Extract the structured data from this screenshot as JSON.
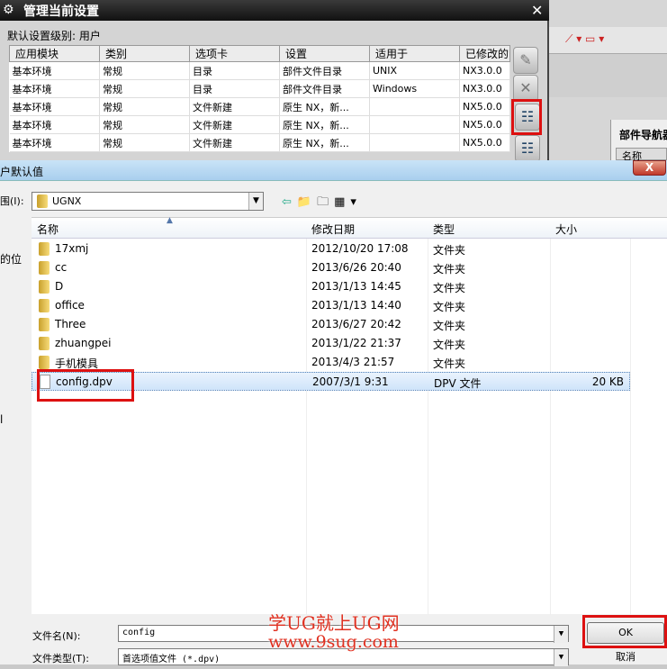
{
  "background_app": {
    "nav_title": "部件导航器",
    "nav_column": "名称"
  },
  "manage_dialog": {
    "title": "管理当前设置",
    "level_label": "默认设置级别: 用户",
    "columns": [
      "应用模块",
      "类别",
      "选项卡",
      "设置",
      "适用于",
      "已修改的"
    ],
    "rows": [
      [
        "基本环境",
        "常规",
        "目录",
        "部件文件目录",
        "UNIX",
        "NX3.0.0"
      ],
      [
        "基本环境",
        "常规",
        "目录",
        "部件文件目录",
        "Windows",
        "NX3.0.0"
      ],
      [
        "基本环境",
        "常规",
        "文件新建",
        "原生 NX，新...",
        "",
        "NX5.0.0"
      ],
      [
        "基本环境",
        "常规",
        "文件新建",
        "原生 NX，新...",
        "",
        "NX5.0.0"
      ],
      [
        "基本环境",
        "常规",
        "文件新建",
        "原生 NX，新...",
        "",
        "NX5.0.0"
      ]
    ]
  },
  "file_dialog": {
    "title": "户默认值",
    "look_in_label": "围(I):",
    "look_in_value": "UGNX",
    "sidebar_fragments": [
      "的位",
      "l"
    ],
    "columns": [
      "名称",
      "修改日期",
      "类型",
      "大小"
    ],
    "files": [
      {
        "name": "17xmj",
        "date": "2012/10/20 17:08",
        "type": "文件夹",
        "size": "",
        "kind": "folder"
      },
      {
        "name": "cc",
        "date": "2013/6/26 20:40",
        "type": "文件夹",
        "size": "",
        "kind": "folder"
      },
      {
        "name": "D",
        "date": "2013/1/13 14:45",
        "type": "文件夹",
        "size": "",
        "kind": "folder"
      },
      {
        "name": "office",
        "date": "2013/1/13 14:40",
        "type": "文件夹",
        "size": "",
        "kind": "folder"
      },
      {
        "name": "Three",
        "date": "2013/6/27 20:42",
        "type": "文件夹",
        "size": "",
        "kind": "folder"
      },
      {
        "name": "zhuangpei",
        "date": "2013/1/22 21:37",
        "type": "文件夹",
        "size": "",
        "kind": "folder"
      },
      {
        "name": "手机模具",
        "date": "2013/4/3 21:57",
        "type": "文件夹",
        "size": "",
        "kind": "folder"
      },
      {
        "name": "config.dpv",
        "date": "2007/3/1 9:31",
        "type": "DPV 文件",
        "size": "20 KB",
        "kind": "file",
        "selected": true
      }
    ],
    "filename_label": "文件名(N):",
    "filename_value": "config",
    "filetype_label": "文件类型(T):",
    "filetype_value": "首选项值文件 (*.dpv)",
    "ok_label": "OK",
    "cancel_label": "取消"
  },
  "watermark": {
    "line1": "学UG就上UG网",
    "line2": "www.9sug.com"
  },
  "highlight_color": "#dd1111"
}
